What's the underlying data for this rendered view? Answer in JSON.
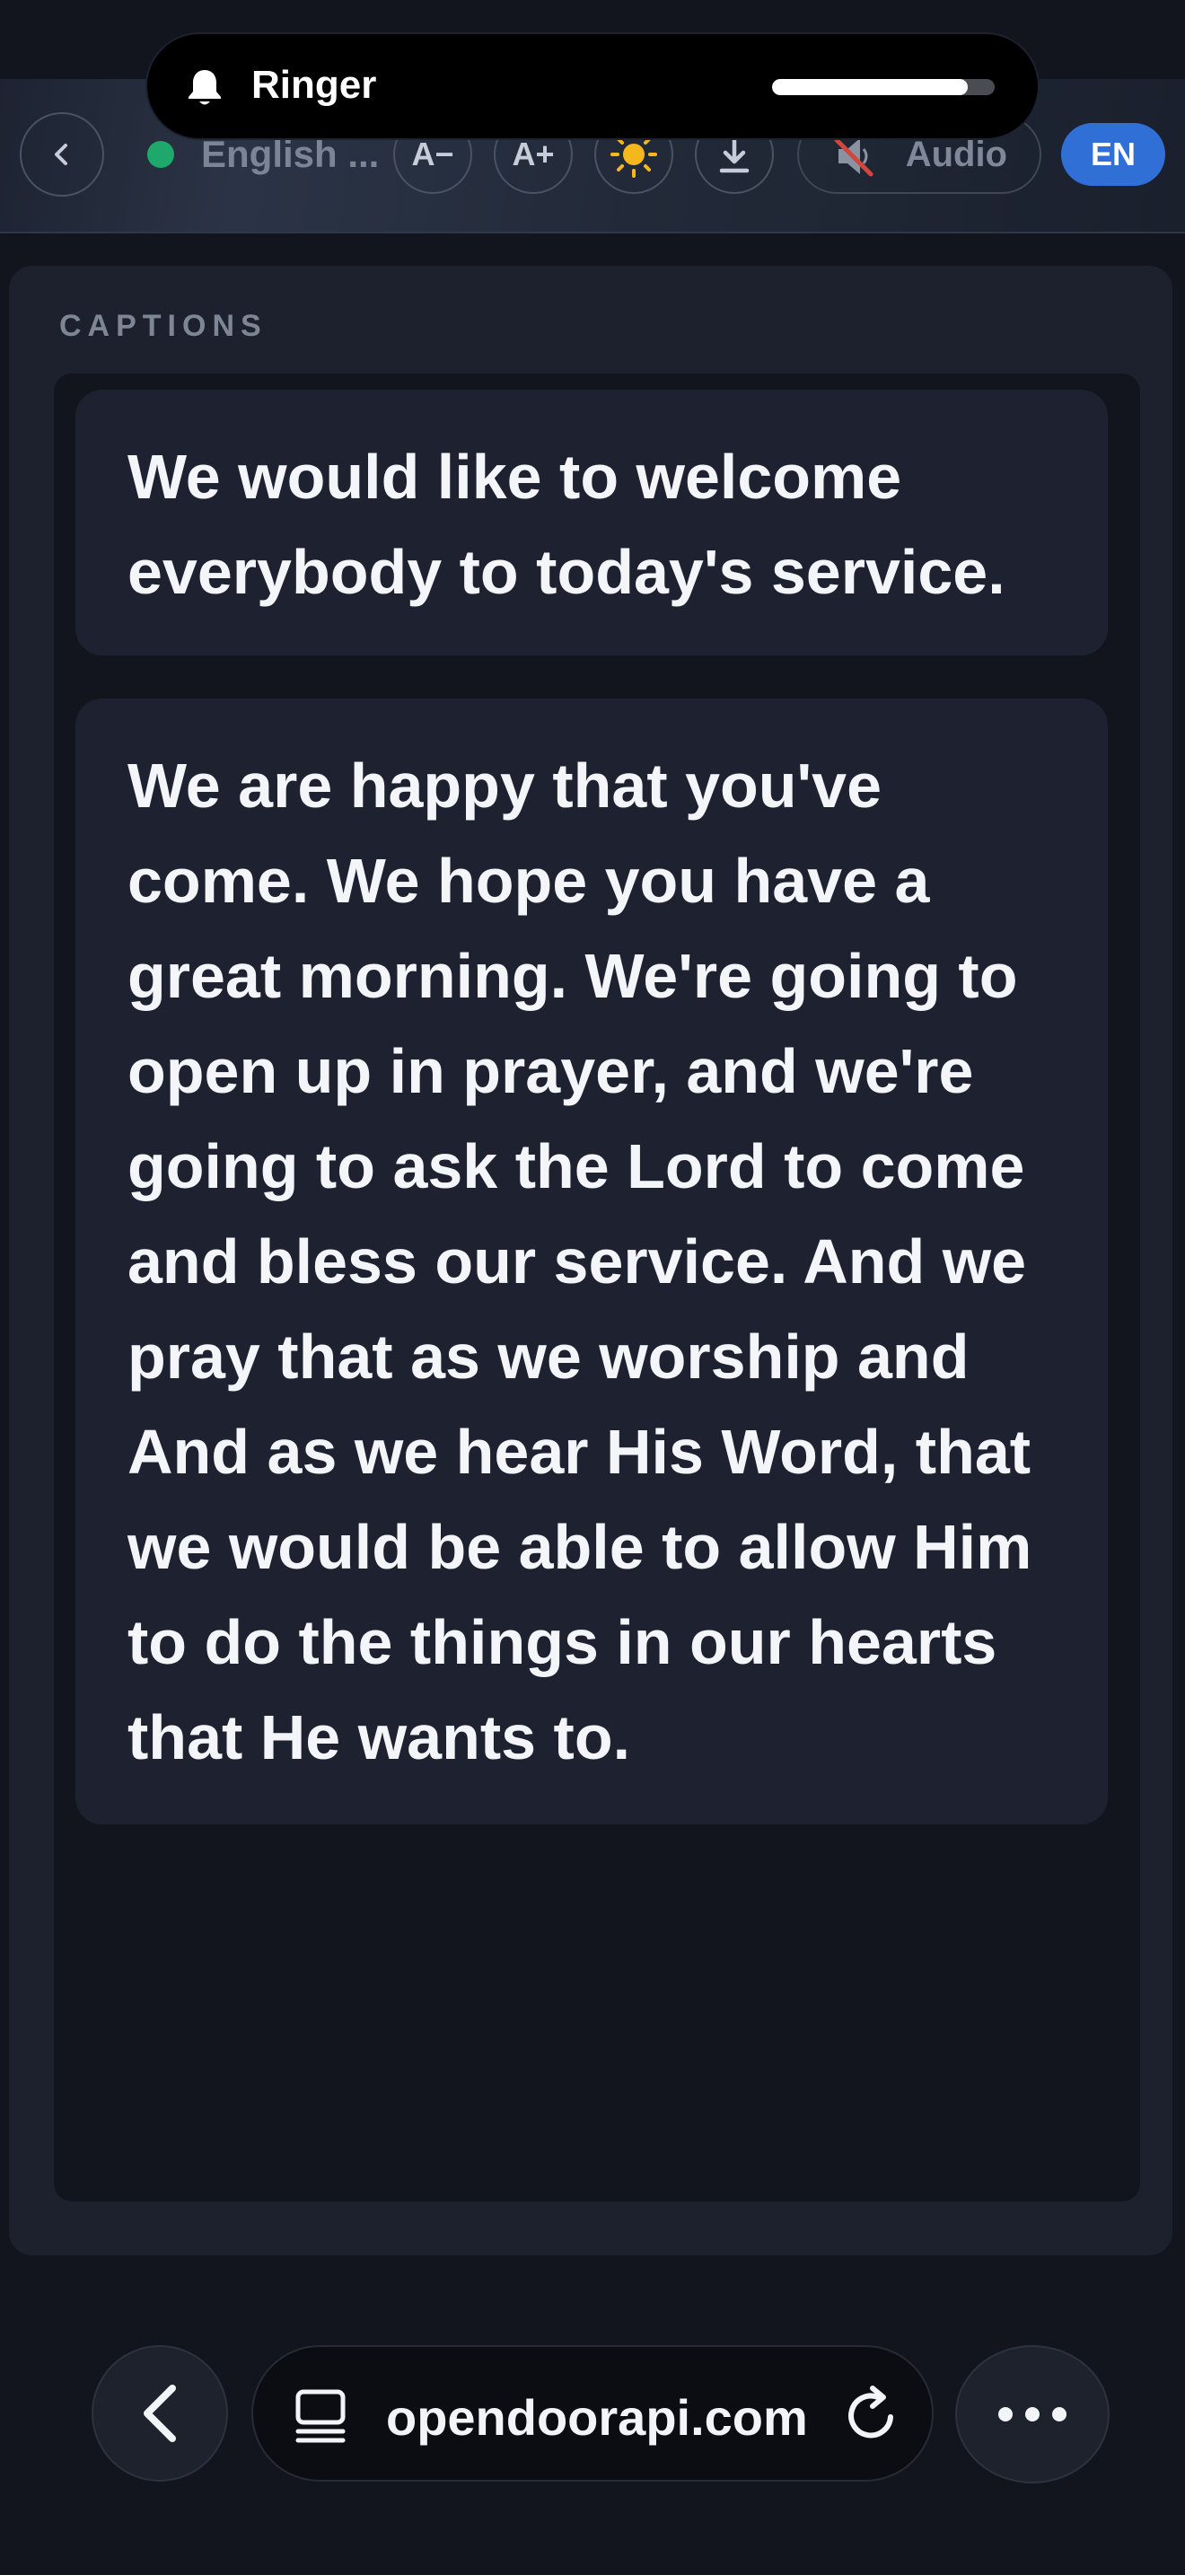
{
  "status_overlay": {
    "label": "Ringer",
    "volume_level": 0.88
  },
  "toolbar": {
    "language_label": "English ...",
    "language_indicator_color": "#1fa86b",
    "decrease_font_label": "A−",
    "increase_font_label": "A+",
    "theme_icon": "sun-icon",
    "download_icon": "download-icon",
    "audio_label": "Audio",
    "audio_icon": "speaker-muted-icon",
    "lang_code": "EN",
    "accent_color": "#2f6fd6"
  },
  "captions": {
    "section_title": "CAPTIONS",
    "items": [
      "We would like to welcome everybody to today's service.",
      "We are happy that you've come. We hope you have a great morning. We're going to open up in prayer, and we're going to ask the Lord to come and bless our service. And we pray that as we worship and And as we hear His Word, that we would be able to allow Him to do the things in our hearts that He wants to."
    ]
  },
  "browser": {
    "url": "opendoorapi.com",
    "back_icon": "chevron-left-icon",
    "tab_icon": "tab-icon",
    "reload_icon": "reload-icon",
    "more_icon": "more-icon"
  }
}
